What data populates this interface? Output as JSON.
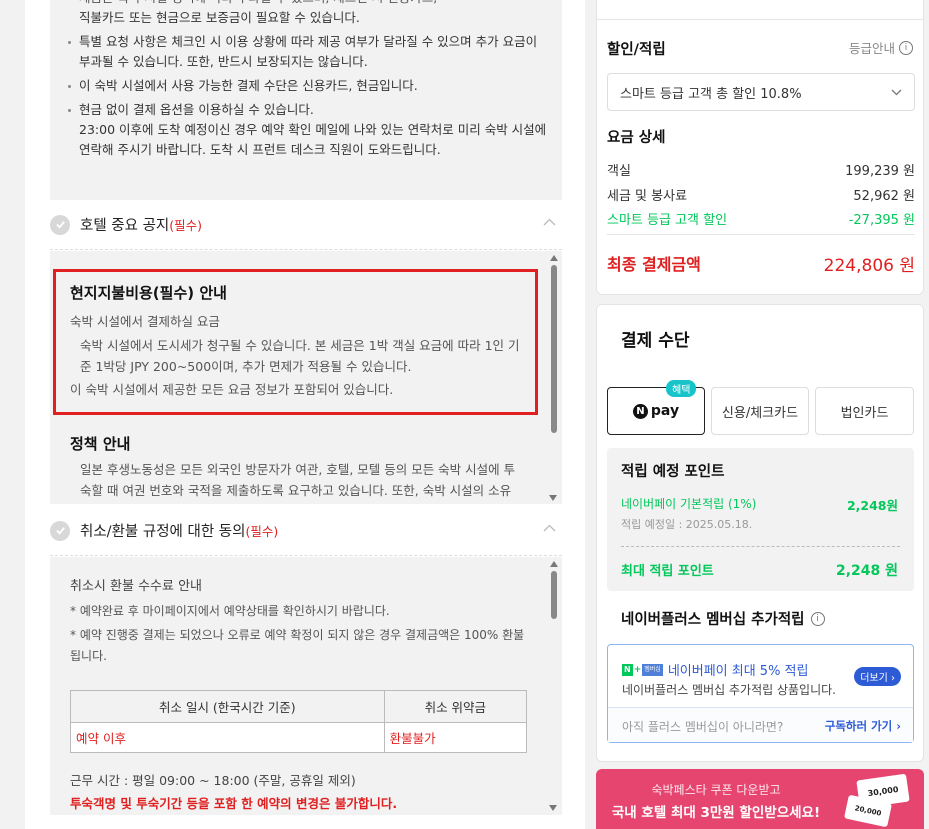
{
  "left": {
    "notice_items": [
      "직불카드 또는 현금으로 보증금이 필요할 수 있습니다.",
      "특별 요청 사항은 체크인 시 이용 상황에 따라 제공 여부가 달라질 수 있으며 추가 요금이 부과될 수 있습니다. 또한, 반드시 보장되지는 않습니다.",
      "이 숙박 시설에서 사용 가능한 결제 수단은 신용카드, 현금입니다.",
      "현금 없이 결제 옵션을 이용하실 수 있습니다.",
      "23:00 이후에 도착 예정이신 경우 예약 확인 메일에 나와 있는 연락처로 미리 숙박 시설에 연락해 주시기 바랍니다. 도착 시 프런트 데스크 직원이 도와드립니다."
    ],
    "hotel_notice": {
      "title": "호텔 중요 공지",
      "required": "(필수)"
    },
    "local_fee": {
      "title": "현지지불비용(필수) 안내",
      "subtitle": "숙박 시설에서 결제하실 요금",
      "detail": "숙박 시설에서 도시세가 청구될 수 있습니다. 본 세금은 1박 객실 요금에 따라 1인 기준 1박당 JPY 200~500이며, 추가 면제가 적용될 수 있습니다.",
      "note": "이 숙박 시설에서 제공한 모든 요금 정보가 포함되어 있습니다."
    },
    "policy": {
      "title": "정책 안내",
      "text": "일본 후생노동성은 모든 외국인 방문자가 여관, 호텔, 모텔 등의 모든 숙박 시설에 투숙할 때 여권 번호와 국적을 제출하도록 요구하고 있습니다. 또한, 숙박 시설의 소유주는 제출된 모든 손님의 여권을 복사하고 해당 복사본을 보관해야 합니다."
    },
    "cancel_agree": {
      "title": "취소/환불 규정에 대한 동의",
      "required": "(필수)"
    },
    "cancel": {
      "fee_title": "취소시 환불 수수료 안내",
      "note1": "* 예약완료 후 마이페이지에서 예약상태를 확인하시기 바랍니다.",
      "note2": "* 예약 진행중 결제는 되었으나 오류로 예약 확정이 되지 않은 경우 결제금액은 100% 환불 됩니다.",
      "table_headers": [
        "취소 일시 (한국시간 기준)",
        "취소 위약금"
      ],
      "table_row": [
        "예약 이후",
        "환불불가"
      ],
      "hours": "근무 시간 : 평일 09:00 ~ 18:00 (주말, 공휴일 제외)",
      "warning": "투숙객명 및 투숙기간 등을 포함 한 예약의 변경은 불가합니다."
    }
  },
  "discount": {
    "title": "할인/적립",
    "grade_info": "등급안내",
    "dropdown": "스마트 등급 고객 총 할인 10.8%"
  },
  "price": {
    "title": "요금 상세",
    "room_label": "객실",
    "room_value": "199,239 원",
    "tax_label": "세금 및 봉사료",
    "tax_value": "52,962 원",
    "smart_label": "스마트 등급 고객 할인",
    "smart_value": "-27,395 원",
    "total_label": "최종 결제금액",
    "total_value": "224,806 원"
  },
  "payment": {
    "title": "결제 수단",
    "badge": "혜택",
    "npay": "pay",
    "card": "신용/체크카드",
    "corp": "법인카드"
  },
  "points": {
    "title": "적립 예정 포인트",
    "basic_label": "네이버페이 기본적립 (1%)",
    "basic_value": "2,248원",
    "date": "적립 예정일 : 2025.05.18.",
    "max_label": "최대 적립 포인트",
    "max_value": "2,248 원"
  },
  "membership": {
    "title": "네이버플러스 멤버십 추가적립",
    "logo_text": "멤버십",
    "headline": "네이버페이 최대 5% 적립",
    "sub": "네이버플러스 멤버십 추가적립 상품입니다.",
    "more": "더보기",
    "question": "아직 플러스 멤버십이 아니라면?",
    "subscribe": "구독하러 가기"
  },
  "banner": {
    "line1": "숙박페스타 쿠폰 다운받고",
    "line2": "국내 호텔 최대 3만원 할인받으세요!",
    "coupon1": "30,000",
    "coupon2": "20,000"
  },
  "colors": {
    "accent_red": "#e02020",
    "naver_green": "#03c75a",
    "banner_pink": "#e5456f"
  }
}
